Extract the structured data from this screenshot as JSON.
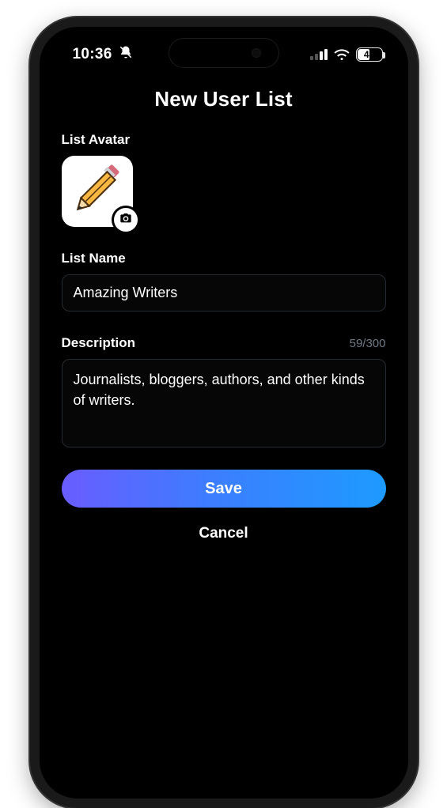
{
  "status": {
    "time": "10:36",
    "battery_percent": "47"
  },
  "header": {
    "title": "New User List"
  },
  "avatar": {
    "label": "List Avatar",
    "icon": "pencil-icon",
    "badge_icon": "camera-icon"
  },
  "name_field": {
    "label": "List Name",
    "value": "Amazing Writers"
  },
  "description_field": {
    "label": "Description",
    "counter": "59/300",
    "value": "Journalists, bloggers, authors, and other kinds of writers."
  },
  "actions": {
    "save_label": "Save",
    "cancel_label": "Cancel"
  }
}
